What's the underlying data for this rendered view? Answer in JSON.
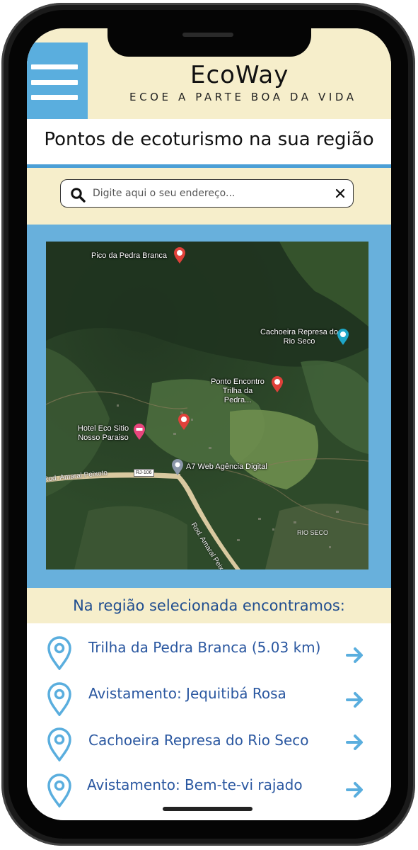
{
  "colors": {
    "header_bg": "#f6eecb",
    "menu_blue": "#5aaede",
    "map_frame": "#68b0dc",
    "link_blue": "#2a57a0",
    "pin_blue": "#5aaede"
  },
  "header": {
    "brand": "EcoWay",
    "tagline": "ECOE A PARTE BOA DA VIDA",
    "menu_icon": "hamburger-icon"
  },
  "page": {
    "title": "Pontos de ecoturismo na sua região"
  },
  "search": {
    "placeholder": "Digite aqui o seu endereço...",
    "value": "",
    "icon": "search-icon",
    "clear_icon": "close-icon"
  },
  "map": {
    "places": [
      {
        "name": "Pico da Pedra Branca",
        "kind": "hiking"
      },
      {
        "name": "Cachoeira Represa do Rio Seco",
        "kind": "attraction"
      },
      {
        "name": "Ponto Encontro Trilha da Pedra...",
        "kind": "hiking"
      },
      {
        "name": "Hotel Eco Sitio Nosso Paraiso",
        "kind": "hotel"
      },
      {
        "name": "A7 Web Agência Digital",
        "kind": "business"
      }
    ],
    "unnamed_hiking_pin": "hiking-icon",
    "road_badge": "RJ-106",
    "road_name": "Rod. Amaral Peixoto",
    "area_label": "RIO SECO"
  },
  "results": {
    "title": "Na região selecionada encontramos:",
    "items": [
      {
        "label": "Trilha da Pedra Branca (5.03 km)",
        "icon": "map-pin-icon",
        "arrow": "arrow-right-icon"
      },
      {
        "label": "Avistamento: Jequitibá Rosa",
        "icon": "map-pin-icon",
        "arrow": "arrow-right-icon"
      },
      {
        "label": "Cachoeira Represa do Rio Seco",
        "icon": "map-pin-icon",
        "arrow": "arrow-right-icon"
      },
      {
        "label": "Avistamento: Bem-te-vi rajado",
        "icon": "map-pin-icon",
        "arrow": "arrow-right-icon"
      }
    ]
  }
}
